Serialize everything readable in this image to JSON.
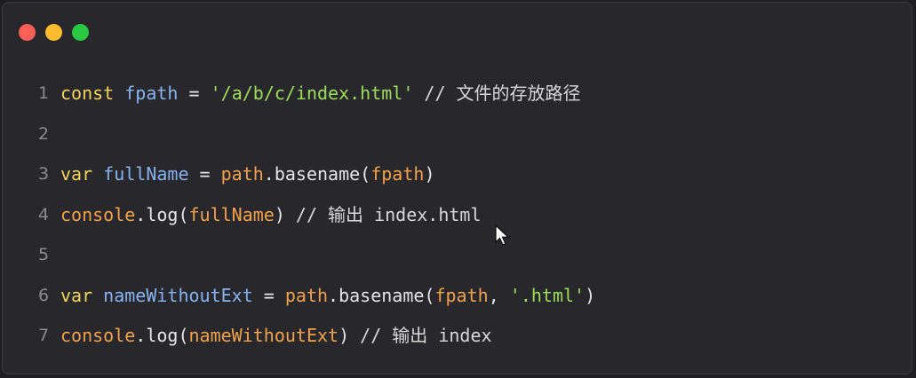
{
  "colors": {
    "close": "#ff5f57",
    "minimize": "#febc2e",
    "maximize": "#28c840",
    "keyword": "#f2d45c",
    "variable": "#87b3f0",
    "string": "#9fdc5a",
    "object": "#f2a24a"
  },
  "code": {
    "lines": [
      {
        "num": "1",
        "tokens": [
          {
            "t": "const",
            "c": "kw"
          },
          {
            "t": " ",
            "c": "op"
          },
          {
            "t": "fpath",
            "c": "var"
          },
          {
            "t": " = ",
            "c": "op"
          },
          {
            "t": "'/a/b/c/index.html'",
            "c": "str"
          },
          {
            "t": " // 文件的存放路径",
            "c": "cm"
          }
        ]
      },
      {
        "num": "2",
        "tokens": []
      },
      {
        "num": "3",
        "tokens": [
          {
            "t": "var",
            "c": "kw"
          },
          {
            "t": " ",
            "c": "op"
          },
          {
            "t": "fullName",
            "c": "var"
          },
          {
            "t": " = ",
            "c": "op"
          },
          {
            "t": "path",
            "c": "obj"
          },
          {
            "t": ".basename(",
            "c": "fn"
          },
          {
            "t": "fpath",
            "c": "obj"
          },
          {
            "t": ")",
            "c": "punc"
          }
        ]
      },
      {
        "num": "4",
        "tokens": [
          {
            "t": "console",
            "c": "obj"
          },
          {
            "t": ".log(",
            "c": "fn"
          },
          {
            "t": "fullName",
            "c": "obj"
          },
          {
            "t": ")",
            "c": "punc"
          },
          {
            "t": " // 输出 index.html",
            "c": "cm"
          }
        ]
      },
      {
        "num": "5",
        "tokens": []
      },
      {
        "num": "6",
        "tokens": [
          {
            "t": "var",
            "c": "kw"
          },
          {
            "t": " ",
            "c": "op"
          },
          {
            "t": "nameWithoutExt",
            "c": "var"
          },
          {
            "t": " = ",
            "c": "op"
          },
          {
            "t": "path",
            "c": "obj"
          },
          {
            "t": ".basename(",
            "c": "fn"
          },
          {
            "t": "fpath",
            "c": "obj"
          },
          {
            "t": ", ",
            "c": "punc"
          },
          {
            "t": "'.html'",
            "c": "str"
          },
          {
            "t": ")",
            "c": "punc"
          }
        ]
      },
      {
        "num": "7",
        "tokens": [
          {
            "t": "console",
            "c": "obj"
          },
          {
            "t": ".log(",
            "c": "fn"
          },
          {
            "t": "nameWithoutExt",
            "c": "obj"
          },
          {
            "t": ")",
            "c": "punc"
          },
          {
            "t": " // 输出 index",
            "c": "cm"
          }
        ]
      }
    ]
  },
  "cursor": {
    "icon": "mouse-pointer-icon"
  }
}
